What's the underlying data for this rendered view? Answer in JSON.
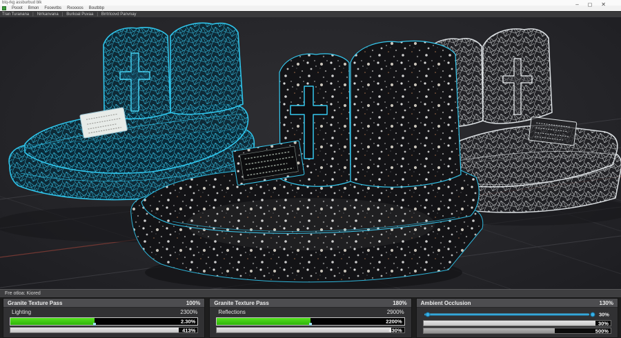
{
  "window": {
    "title": "blq-rkg assburbud blk",
    "controls": {
      "minimize": "–",
      "maximize": "◻",
      "close": "✕"
    }
  },
  "menu": {
    "items": [
      "Pooot",
      "Bmon",
      "Fooevtbs",
      "Rxoooos",
      "Boutbbp"
    ]
  },
  "toolbar": {
    "separator": "|",
    "items": [
      "Tran Turanana",
      "Nrrkanvana",
      "Burkoal Puvaa",
      "Brrtrlcovd Panvnay"
    ]
  },
  "viewport": {
    "models": [
      {
        "name": "wireframe-cyan-monument"
      },
      {
        "name": "granite-textured-monument"
      },
      {
        "name": "wireframe-white-monument"
      }
    ],
    "colors": {
      "wireframe_cyan": "#2fc4ea",
      "wireframe_white": "#dde1e4",
      "granite_base": "#131316",
      "edge_highlight": "#35c8ee",
      "grid_line": "#3a3a3f",
      "axis_red": "#7a3a34"
    }
  },
  "status_bar": {
    "text": "Fre otloa: Kiored"
  },
  "panels": [
    {
      "title": "Granite Texture Pass",
      "title_value": "100%",
      "row_label": "Lighting",
      "row_value": "2300%",
      "bar1": {
        "label": "2.30%",
        "fill_pct": 45
      },
      "bar2": {
        "label": "413%",
        "fill_pct": 90
      }
    },
    {
      "title": "Granite Texture Pass",
      "title_value": "180%",
      "row_label": "Reflections",
      "row_value": "2900%",
      "bar1": {
        "label": "2200%",
        "fill_pct": 50
      },
      "bar2": {
        "label": "430%",
        "fill_pct": 93
      }
    },
    {
      "title": "Ambient Occlusion",
      "title_value": "130%",
      "slider": {
        "label": "30%",
        "handle_pct": 90
      },
      "bar1": {
        "label": "30%",
        "fill_pct": 92
      },
      "bar2": {
        "label": "500%",
        "fill_pct": 70
      }
    }
  ]
}
